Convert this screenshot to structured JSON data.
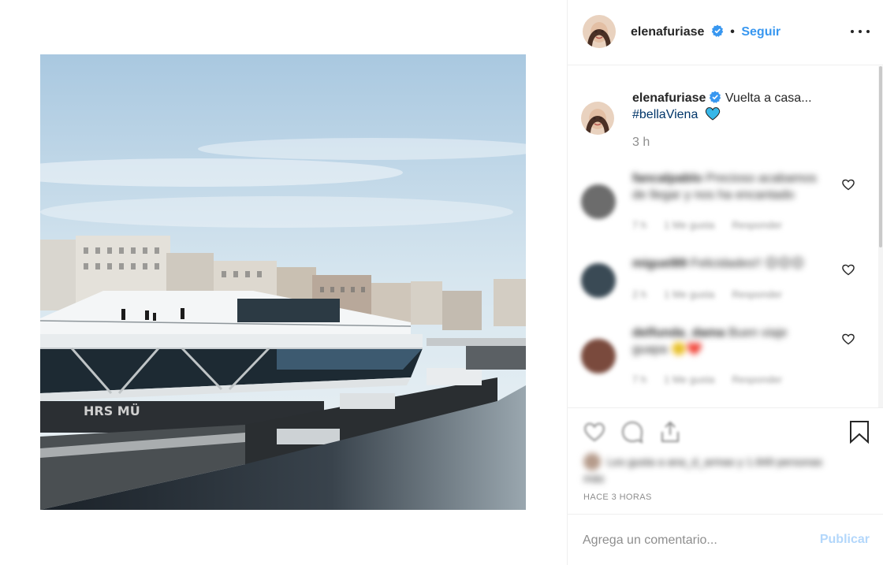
{
  "post": {
    "username": "elenafuriase",
    "verified": true,
    "follow_label": "Seguir",
    "separator": "•",
    "photo": {
      "description": "Vienna canal river cruise terminal with buildings"
    },
    "caption": {
      "username": "elenafuriase",
      "text": "Vuelta a casa...",
      "hashtag": "#bellaViena",
      "emoji": "blue-heart-icon",
      "time": "3 h"
    },
    "comments": [
      {
        "user": "fancalpablo",
        "text": "Precioso acabamos de llegar y nos ha encantado",
        "meta": [
          "7 h",
          "1 Me gusta",
          "Responder"
        ]
      },
      {
        "user": "miguel89",
        "text": "Felicidades!! 😊😊😊",
        "meta": [
          "2 h",
          "1 Me gusta",
          "Responder"
        ]
      },
      {
        "user": "delfunda_dama",
        "text": "Buen viaje guapa 🙂❤️",
        "meta": [
          "7 h",
          "1 Me gusta",
          "Responder"
        ]
      }
    ],
    "likes_text": "Les gusta a ana_d_armas y 1.849 personas más",
    "timestamp": "HACE 3 HORAS",
    "add_comment_placeholder": "Agrega un comentario...",
    "publish_label": "Publicar"
  },
  "colors": {
    "accent": "#3897f0",
    "publish_disabled": "#b3d7fb",
    "muted": "#8e8e8e",
    "verified": "#3897f0"
  }
}
